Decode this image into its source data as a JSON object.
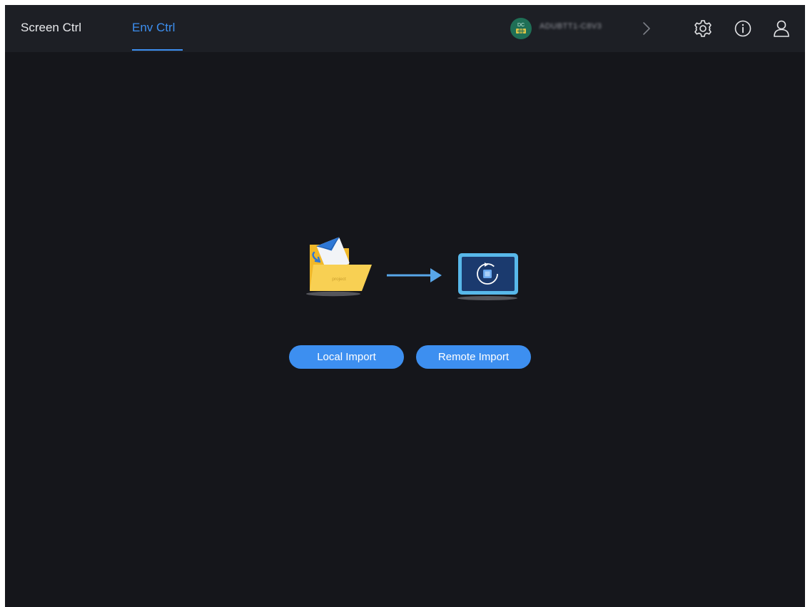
{
  "tabs": [
    {
      "label": "Screen Ctrl",
      "active": false
    },
    {
      "label": "Env Ctrl",
      "active": true
    }
  ],
  "device": {
    "name": "ADUBTT1-C8V3",
    "badge": "DC",
    "icon": "device-server-icon",
    "chevron_icon": "chevron-right-icon"
  },
  "header_actions": [
    {
      "icon": "gear-icon"
    },
    {
      "icon": "info-icon"
    },
    {
      "icon": "user-icon"
    }
  ],
  "illustration": {
    "folder_label": "project",
    "folder_icon": "project-folder-icon",
    "arrow_icon": "arrow-right-icon",
    "target_icon": "screen-sync-icon"
  },
  "actions": {
    "local_import": "Local Import",
    "remote_import": "Remote Import"
  },
  "colors": {
    "accent": "#3d8ff0",
    "background": "#15161b",
    "header": "#1d1f25",
    "folder": "#f9cf4a"
  }
}
